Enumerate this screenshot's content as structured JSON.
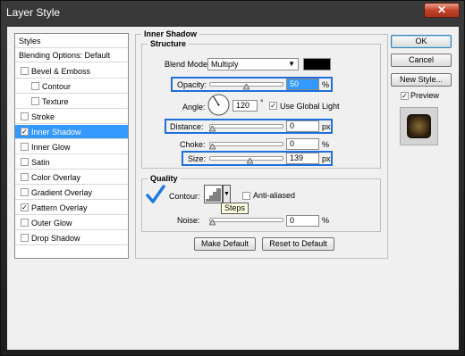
{
  "window": {
    "title": "Layer Style",
    "close_label": "✕"
  },
  "styles_list": {
    "header": "Styles",
    "blending": "Blending Options: Default",
    "items": [
      {
        "label": "Bevel & Emboss",
        "checked": false,
        "selected": false,
        "indent": false
      },
      {
        "label": "Contour",
        "checked": false,
        "selected": false,
        "indent": true
      },
      {
        "label": "Texture",
        "checked": false,
        "selected": false,
        "indent": true
      },
      {
        "label": "Stroke",
        "checked": false,
        "selected": false,
        "indent": false
      },
      {
        "label": "Inner Shadow",
        "checked": true,
        "selected": true,
        "indent": false
      },
      {
        "label": "Inner Glow",
        "checked": false,
        "selected": false,
        "indent": false
      },
      {
        "label": "Satin",
        "checked": false,
        "selected": false,
        "indent": false
      },
      {
        "label": "Color Overlay",
        "checked": false,
        "selected": false,
        "indent": false
      },
      {
        "label": "Gradient Overlay",
        "checked": false,
        "selected": false,
        "indent": false
      },
      {
        "label": "Pattern Overlay",
        "checked": true,
        "selected": false,
        "indent": false
      },
      {
        "label": "Outer Glow",
        "checked": false,
        "selected": false,
        "indent": false
      },
      {
        "label": "Drop Shadow",
        "checked": false,
        "selected": false,
        "indent": false
      }
    ]
  },
  "main": {
    "section_title": "Inner Shadow",
    "structure": {
      "title": "Structure",
      "blend_mode_label": "Blend Mode:",
      "blend_mode_value": "Multiply",
      "blend_color": "#000000",
      "opacity_label": "Opacity:",
      "opacity_value": "50",
      "opacity_unit": "%",
      "opacity_level": 0.5,
      "angle_label": "Angle:",
      "angle_value": "120",
      "angle_unit": "°",
      "use_global_light_label": "Use Global Light",
      "use_global_light_checked": true,
      "distance_label": "Distance:",
      "distance_value": "0",
      "distance_unit": "px",
      "distance_level": 0.0,
      "choke_label": "Choke:",
      "choke_value": "0",
      "choke_unit": "%",
      "choke_level": 0.0,
      "size_label": "Size:",
      "size_value": "139",
      "size_unit": "px",
      "size_level": 0.55
    },
    "quality": {
      "title": "Quality",
      "contour_label": "Contour:",
      "anti_aliased_label": "Anti-aliased",
      "anti_aliased_checked": false,
      "tooltip": "Steps",
      "noise_label": "Noise:",
      "noise_value": "0",
      "noise_unit": "%",
      "noise_level": 0.0
    },
    "make_default_label": "Make Default",
    "reset_default_label": "Reset to Default"
  },
  "actions": {
    "ok_label": "OK",
    "cancel_label": "Cancel",
    "new_style_label": "New Style...",
    "preview_label": "Preview",
    "preview_checked": true
  },
  "colors": {
    "highlight": "#1f6fdc",
    "selection": "#3399ff",
    "checkmark": "#1e7be0"
  }
}
